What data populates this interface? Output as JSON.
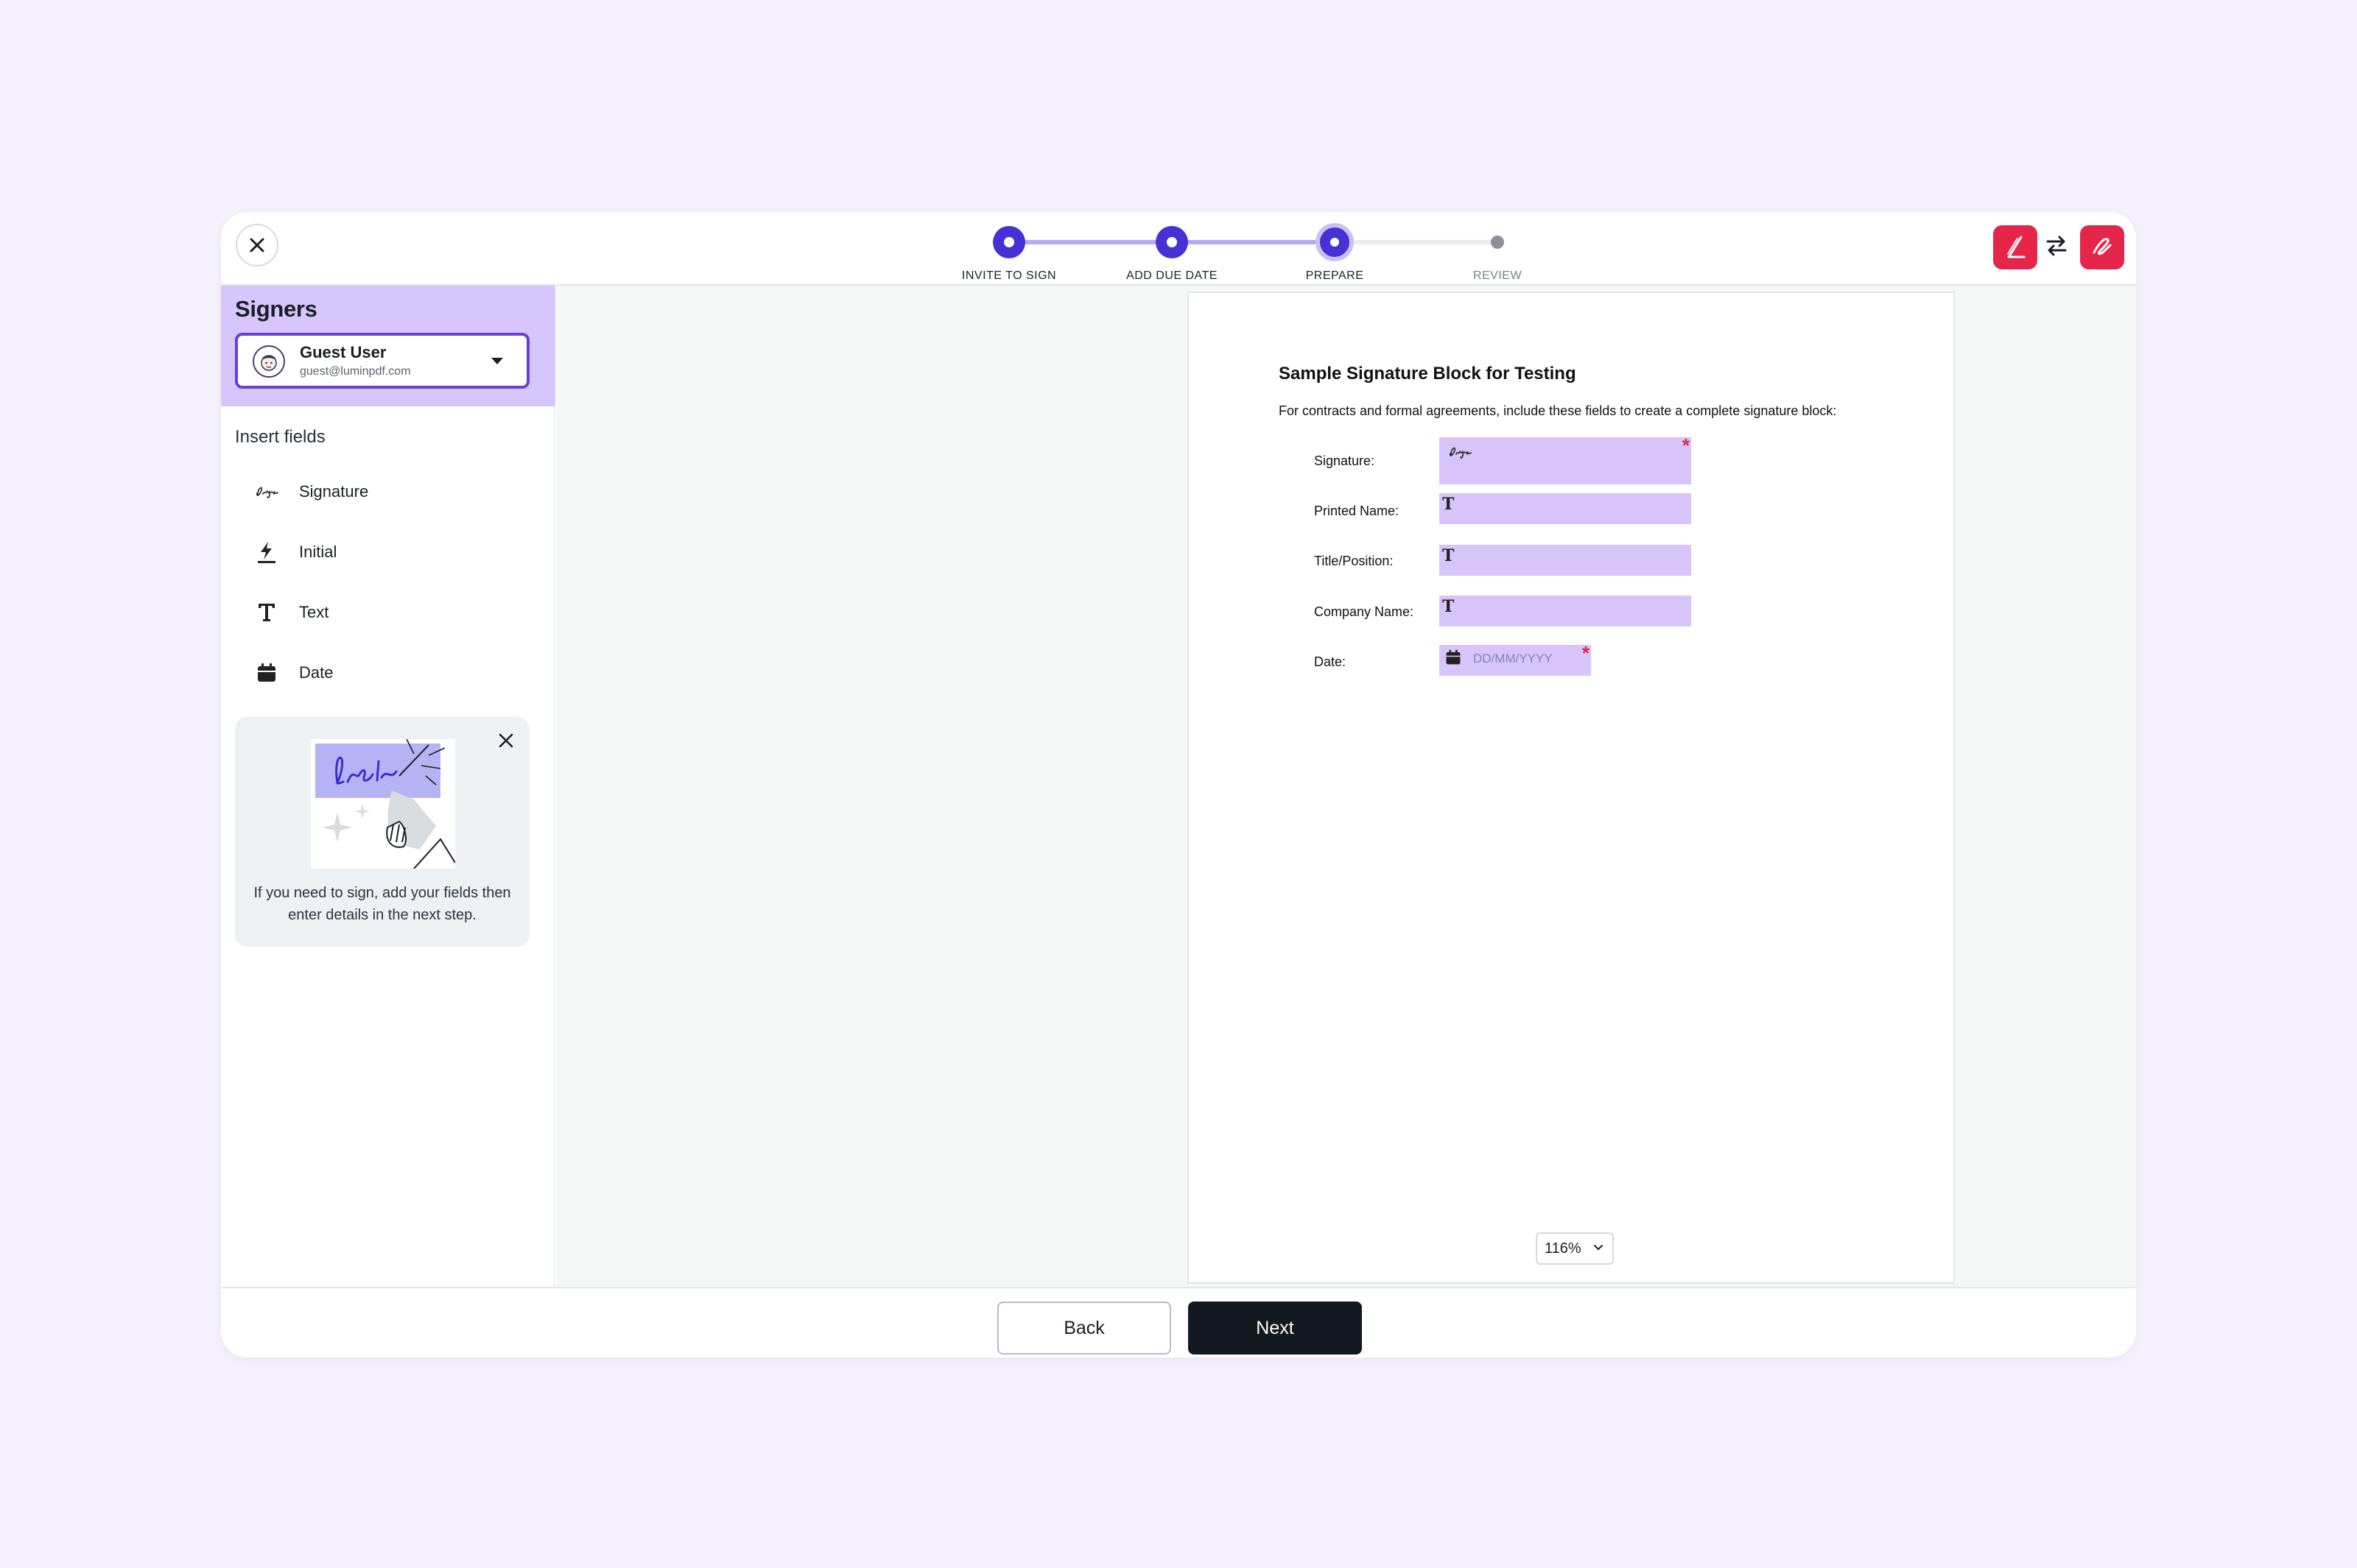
{
  "stepper": {
    "steps": [
      {
        "label": "INVITE TO SIGN",
        "state": "done"
      },
      {
        "label": "ADD DUE DATE",
        "state": "done"
      },
      {
        "label": "PREPARE",
        "state": "current"
      },
      {
        "label": "REVIEW",
        "state": "todo"
      }
    ]
  },
  "brand": {
    "accent": "#e5254a",
    "primary": "#4831d4"
  },
  "sidebar": {
    "signers_title": "Signers",
    "selected_signer": {
      "name": "Guest User",
      "email": "guest@luminpdf.com"
    },
    "insert_fields_title": "Insert fields",
    "fields": [
      {
        "label": "Signature",
        "icon": "signature-icon"
      },
      {
        "label": "Initial",
        "icon": "initial-icon"
      },
      {
        "label": "Text",
        "icon": "text-icon"
      },
      {
        "label": "Date",
        "icon": "calendar-icon"
      }
    ],
    "tip": {
      "text": "If you need to sign, add your fields then enter details in the next step."
    }
  },
  "document": {
    "title": "Sample Signature Block for Testing",
    "intro": "For contracts and formal agreements, include these fields to create a complete signature block:",
    "rows": [
      {
        "label": "Signature:",
        "field": "signature",
        "required": true
      },
      {
        "label": "Printed Name:",
        "field": "text",
        "required": false
      },
      {
        "label": "Title/Position:",
        "field": "text",
        "required": false
      },
      {
        "label": "Company Name:",
        "field": "text",
        "required": false
      },
      {
        "label": "Date:",
        "field": "date",
        "required": true,
        "placeholder": "DD/MM/YYYY"
      }
    ],
    "required_mark": "*",
    "text_glyph": "T"
  },
  "zoom": {
    "value": "116%"
  },
  "footer": {
    "back_label": "Back",
    "next_label": "Next"
  }
}
